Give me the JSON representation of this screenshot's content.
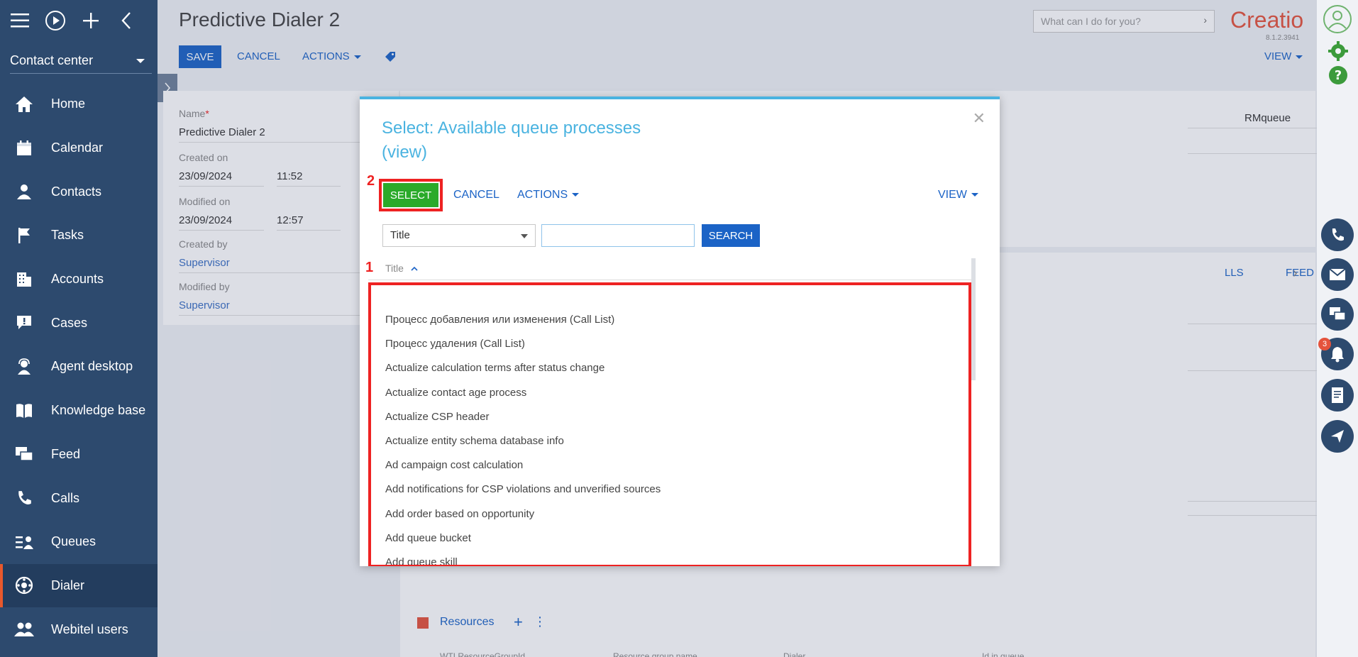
{
  "sidebar": {
    "workspace": "Contact center",
    "items": [
      {
        "label": "Home",
        "icon": "home-icon"
      },
      {
        "label": "Calendar",
        "icon": "calendar-icon"
      },
      {
        "label": "Contacts",
        "icon": "contact-icon"
      },
      {
        "label": "Tasks",
        "icon": "flag-icon"
      },
      {
        "label": "Accounts",
        "icon": "building-icon"
      },
      {
        "label": "Cases",
        "icon": "case-icon"
      },
      {
        "label": "Agent desktop",
        "icon": "headset-icon"
      },
      {
        "label": "Knowledge base",
        "icon": "book-icon"
      },
      {
        "label": "Feed",
        "icon": "chat-icon"
      },
      {
        "label": "Calls",
        "icon": "phone-icon"
      },
      {
        "label": "Queues",
        "icon": "queue-icon"
      },
      {
        "label": "Dialer",
        "icon": "dialer-icon"
      },
      {
        "label": "Webitel users",
        "icon": "users-icon"
      }
    ],
    "active_item": "Dialer"
  },
  "header": {
    "title": "Predictive Dialer 2",
    "save_label": "SAVE",
    "cancel_label": "CANCEL",
    "actions_label": "ACTIONS",
    "view_label": "VIEW",
    "search_placeholder": "What can I do for you?",
    "logo": "Creatio",
    "version": "8.1.2.3941"
  },
  "record": {
    "name_label": "Name",
    "name_value": "Predictive Dialer 2",
    "created_on_label": "Created on",
    "created_date": "23/09/2024",
    "created_time": "11:52",
    "modified_on_label": "Modified on",
    "modified_date": "23/09/2024",
    "modified_time": "12:57",
    "created_by_label": "Created by",
    "created_by": "Supervisor",
    "modified_by_label": "Modified by",
    "modified_by": "Supervisor",
    "queue_fragment": "RMqueue",
    "tab_calls_fragment": "LLS",
    "tab_feed": "FEED",
    "resources_label": "Resources",
    "columns_fragment": [
      "WTI ResourceGroupId",
      "Resource group name",
      "Dialer",
      "Id in queue"
    ]
  },
  "modal": {
    "title_line1": "Select: Available queue processes",
    "title_line2": "(view)",
    "select_label": "SELECT",
    "cancel_label": "CANCEL",
    "actions_label": "ACTIONS",
    "view_label": "VIEW",
    "filter_field": "Title",
    "search_label": "SEARCH",
    "column_title": "Title",
    "annotation_list": "1",
    "annotation_select": "2",
    "rows": [
      "Процесс добавления или изменения (Call List)",
      "Процесс удаления (Call List)",
      "Actualize calculation terms after status change",
      "Actualize contact age process",
      "Actualize CSP header",
      "Actualize entity schema database info",
      "Ad campaign cost calculation",
      "Add notifications for CSP violations and unverified sources",
      "Add order based on opportunity",
      "Add queue bucket",
      "Add queue skill"
    ]
  },
  "rail": {
    "notification_count": "3"
  },
  "colors": {
    "sidebar_bg": "#2d4a6e",
    "accent_blue": "#1b63c6",
    "select_green": "#2aaa2a",
    "annotation_red": "#e22222",
    "modal_title": "#4ab3e0",
    "brand": "#e5533c"
  }
}
